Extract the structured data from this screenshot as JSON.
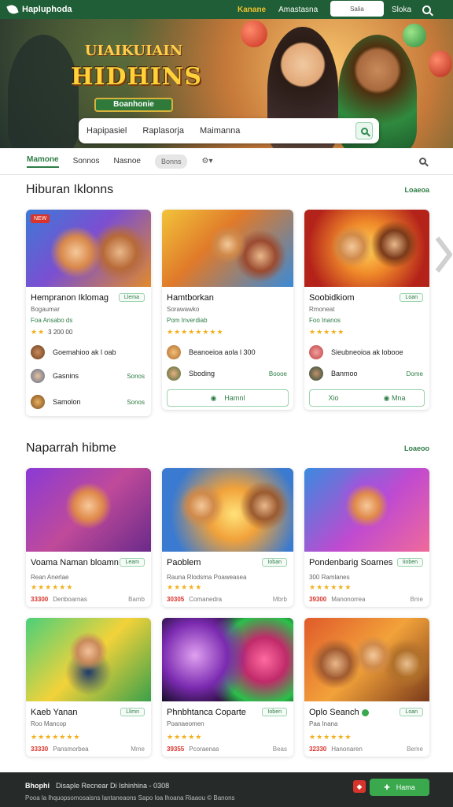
{
  "colors": {
    "nav_bg": "#1f5e36",
    "accent_green": "#2e7d46",
    "star": "#f2b01e",
    "price_red": "#d7342b"
  },
  "topbar": {
    "brand": "Hapluphoda",
    "nav": [
      "Kanane",
      "Amastasna"
    ],
    "search_placeholder": "Salia",
    "right_label": "Sloka"
  },
  "hero": {
    "logo_pre": "UIAIKUIAIN",
    "logo_title": "HIDHINS",
    "logo_sub": "Boanhonie",
    "search_segments": [
      "Hapipasiel",
      "Raplasorja",
      "Maimanna"
    ]
  },
  "tabs": {
    "items": [
      "Mamone",
      "Sonnos",
      "Nasnoe"
    ],
    "pill": "Bonns"
  },
  "section1": {
    "title": "Hiburan Iklonns",
    "more": "Loaeoa",
    "cards": [
      {
        "badge": "NEW",
        "title": "Hempranon Iklomag",
        "tag": "Llema",
        "line1": "Bogaumar",
        "line2": "Foa Ansabo ds",
        "stars": "★★",
        "rating": "3 200 00",
        "rows": [
          {
            "text": "Goemahioo ak l oab",
            "right": ""
          },
          {
            "text": "Gasnins",
            "right": "Sonos"
          },
          {
            "text": "Samolon",
            "right": "Sonos"
          }
        ]
      },
      {
        "title": "Hamtborkan",
        "tag": "",
        "line1": "Sorawawko",
        "line2": "Pom Inverdiab",
        "stars": "★★★★★★★★",
        "rating": "",
        "rows": [
          {
            "text": "Beanoeioa aola l 300",
            "right": ""
          },
          {
            "text": "Sboding",
            "right": "Boooe"
          }
        ],
        "button": "Hamnl"
      },
      {
        "title": "Soobidkiom",
        "tag": "Loan",
        "line1": "Rmoneat",
        "line2": "Foo Inanos",
        "stars": "★★★★★",
        "rating": "",
        "rows": [
          {
            "text": "Sieubneoioa ak lobooe",
            "right": ""
          },
          {
            "text": "Banmoo",
            "right": "Dome"
          }
        ],
        "button_left": "Xio",
        "button_right": "Mna"
      }
    ]
  },
  "section2": {
    "title": "Naparrah hibme",
    "more": "Loaeoo",
    "cards": [
      {
        "title": "Voama Naman bloamn",
        "tag": "Leam",
        "line1": "Rean Anerlae",
        "stars": "★★★★★★",
        "price": "33300",
        "price_note": "Denboarnas",
        "price_right": "Bamb"
      },
      {
        "title": "Paoblem",
        "tag": "Ioban",
        "line1": "Rauna Rlodsma  Poaweasea",
        "stars": "★★★★★",
        "price": "30305",
        "price_note": "Comanedra",
        "price_right": "Mbrb"
      },
      {
        "title": "Pondenbarig Soarnes",
        "tag": "Iioben",
        "line1": "300 Ramlanes",
        "stars": "★★★★★★",
        "price": "39300",
        "price_note": "Manonorrea",
        "price_right": "Bme"
      },
      {
        "title": "Kaeb Yanan",
        "tag": "Llimn",
        "line1": "Roo Mancop",
        "stars": "★★★★★★★",
        "price": "33330",
        "price_note": "Pansmorbea",
        "price_right": "Mme"
      },
      {
        "title": "Phnbhtanca Coparte",
        "tag": "Ioben",
        "line1": "Poanaeomen",
        "stars": "★★★★★",
        "price": "39355",
        "price_note": "Pcoraenas",
        "price_right": "Beas"
      },
      {
        "title": "Oplo Seanch",
        "tag": "Loan",
        "line1": "Paa Inana",
        "stars": "★★★★★★",
        "price": "32330",
        "price_note": "Hanonaren",
        "price_right": "Beme"
      }
    ]
  },
  "footer": {
    "line1_bold": "Bhophi",
    "line1": "Disaple Recnear  Di Ishinhina - 0308",
    "line2": "Pooa la lhquopsomosaisns lantaneaons  Sapo loa lhoana Riaaou  ©  Banons",
    "cta": "Hama"
  }
}
